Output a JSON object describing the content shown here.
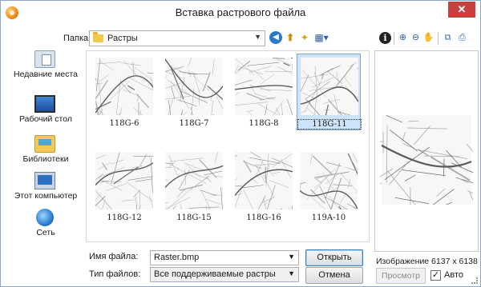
{
  "window": {
    "title": "Вставка растрового файла"
  },
  "folder": {
    "label": "Папка:",
    "value": "Растры"
  },
  "places": [
    {
      "id": "recent",
      "label": "Недавние места"
    },
    {
      "id": "desktop",
      "label": "Рабочий стол"
    },
    {
      "id": "libraries",
      "label": "Библиотеки"
    },
    {
      "id": "computer",
      "label": "Этот компьютер"
    },
    {
      "id": "network",
      "label": "Сеть"
    }
  ],
  "files": [
    {
      "name": "118G-6",
      "selected": false
    },
    {
      "name": "118G-7",
      "selected": false
    },
    {
      "name": "118G-8",
      "selected": false
    },
    {
      "name": "118G-11",
      "selected": true
    },
    {
      "name": "118G-12",
      "selected": false
    },
    {
      "name": "118G-15",
      "selected": false
    },
    {
      "name": "118G-16",
      "selected": false
    },
    {
      "name": "119A-10",
      "selected": false
    }
  ],
  "filename": {
    "label": "Имя файла:",
    "value": "Raster.bmp"
  },
  "filetype": {
    "label": "Тип файлов:",
    "value": "Все поддерживаемые растры"
  },
  "buttons": {
    "open": "Открыть",
    "cancel": "Отмена",
    "preview": "Просмотр"
  },
  "preview": {
    "image_size": "Изображение 6137 x 6138",
    "auto_label": "Авто",
    "auto_checked": true
  },
  "icons": {
    "app": "app-icon",
    "close": "close-icon",
    "folder": "folder-icon",
    "chevron": "chevron-down-icon",
    "back": "back-icon",
    "up": "up-folder-icon",
    "newfolder": "new-folder-icon",
    "views": "view-menu-icon",
    "info": "info-icon",
    "zoom_in": "zoom-in-icon",
    "zoom_out": "zoom-out-icon",
    "pan": "hand-pan-icon",
    "fit": "fit-icon",
    "print": "print-preview-icon"
  }
}
